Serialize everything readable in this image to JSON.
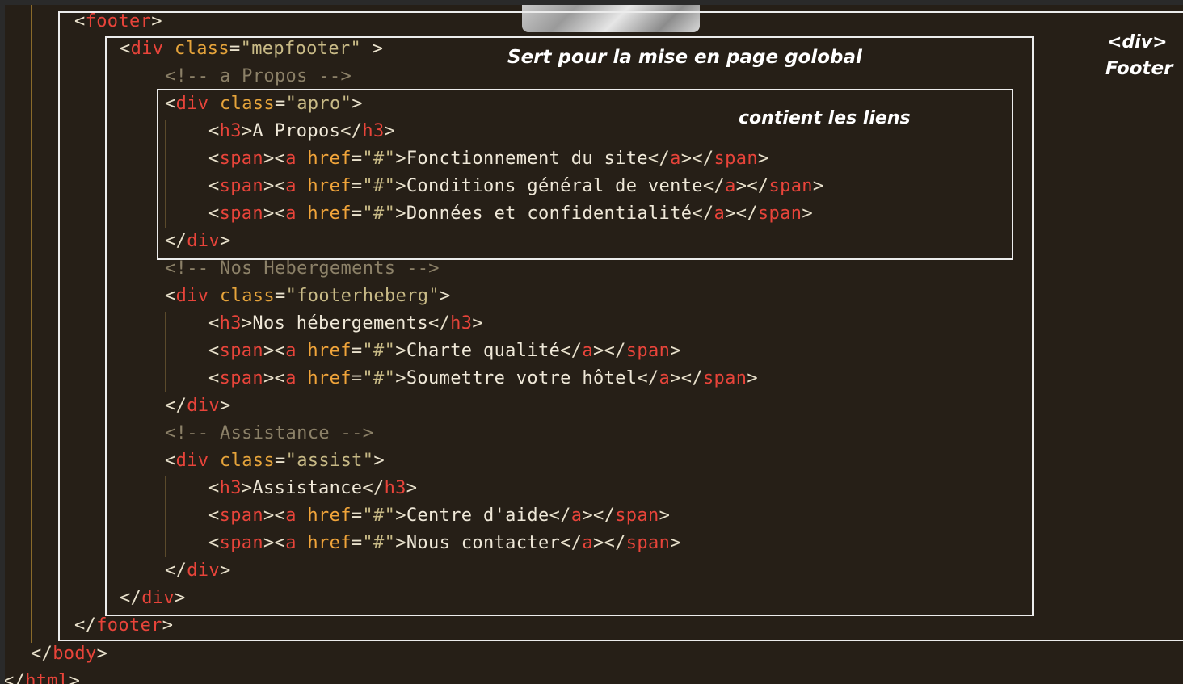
{
  "code": {
    "footer_open_tag": "footer",
    "mepfooter_class": "\"mepfooter\"",
    "comment_apropos": "<!-- a Propos -->",
    "apro_class": "\"apro\"",
    "apro_h3": "A Propos",
    "link_fonctionnement": "Fonctionnement du site",
    "link_conditions": "Conditions général de vente",
    "link_donnees": "Données et confidentialité",
    "comment_hebergements": "<!-- Nos Hebergements -->",
    "footerheberg_class": "\"footerheberg\"",
    "heberg_h3": "Nos hébergements",
    "link_charte": "Charte qualité",
    "link_soumettre": "Soumettre votre hôtel",
    "comment_assistance": "<!-- Assistance -->",
    "assist_class": "\"assist\"",
    "assist_h3": "Assistance",
    "link_centre": "Centre d'aide",
    "link_contacter": "Nous contacter",
    "href_value": "\"#\"",
    "body_close": "body",
    "html_close": "html"
  },
  "annotations": {
    "global_layout": "Sert pour la mise en page golobal",
    "contains_links": "contient les liens",
    "div_label": "<div>",
    "footer_label": "Footer"
  }
}
